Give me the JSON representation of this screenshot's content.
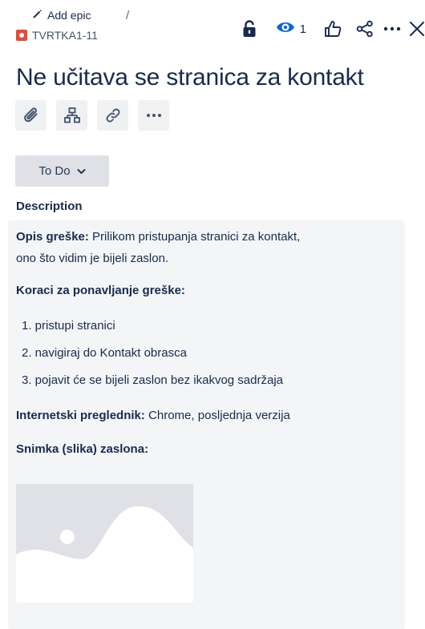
{
  "breadcrumb": {
    "add_epic": "Add epic",
    "separator": "/",
    "issue_key": "TVRTKA1-11"
  },
  "header": {
    "watch_count": "1",
    "accent": "#0c66e4"
  },
  "issue": {
    "title": "Ne učitava se stranica za kontakt"
  },
  "toolbar": {
    "buttons": [
      "attachment-icon",
      "child-issue-icon",
      "link-icon",
      "more-icon"
    ]
  },
  "status": {
    "label": "To Do"
  },
  "description": {
    "label": "Description",
    "opis_label": "Opis greške:",
    "opis_text": " Prilikom pristupanja stranici za kontakt,",
    "opis_text2": "ono što vidim je bijeli zaslon.",
    "koraci_heading": "Koraci za ponavljanje greške:",
    "steps": [
      "1. pristupi stranici",
      "2. navigiraj do Kontakt obrasca",
      "3. pojavit će se bijeli zaslon bez ikakvog sadržaja"
    ],
    "browser_label": "Internetski preglednik:",
    "browser_value": " Chrome, posljednja verzija",
    "screenshot_label": "Snimka (slika) zaslona:"
  }
}
